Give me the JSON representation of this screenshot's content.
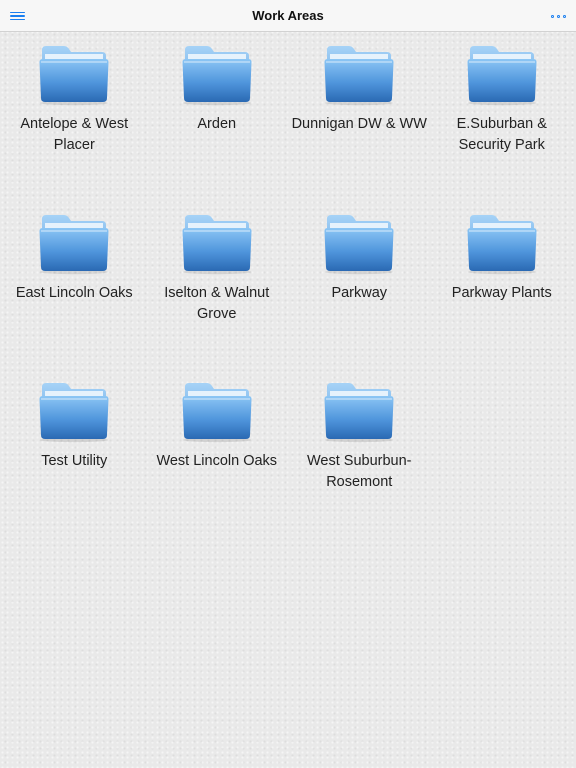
{
  "navbar": {
    "title": "Work Areas",
    "menu_icon": "hamburger-menu-icon",
    "more_icon": "more-options-icon"
  },
  "folder_icon": "folder-icon",
  "colors": {
    "accent": "#1a7ff0",
    "folder_light": "#8cc6f5",
    "folder_dark": "#2a69b3"
  },
  "work_areas": [
    {
      "label": "Antelope & West Placer"
    },
    {
      "label": "Arden"
    },
    {
      "label": "Dunnigan DW & WW"
    },
    {
      "label": "E.Suburban & Security Park"
    },
    {
      "label": "East Lincoln Oaks"
    },
    {
      "label": "Iselton & Walnut Grove"
    },
    {
      "label": "Parkway"
    },
    {
      "label": "Parkway Plants"
    },
    {
      "label": "Test Utility"
    },
    {
      "label": "West Lincoln Oaks"
    },
    {
      "label": "West Suburbun-Rosemont"
    }
  ]
}
